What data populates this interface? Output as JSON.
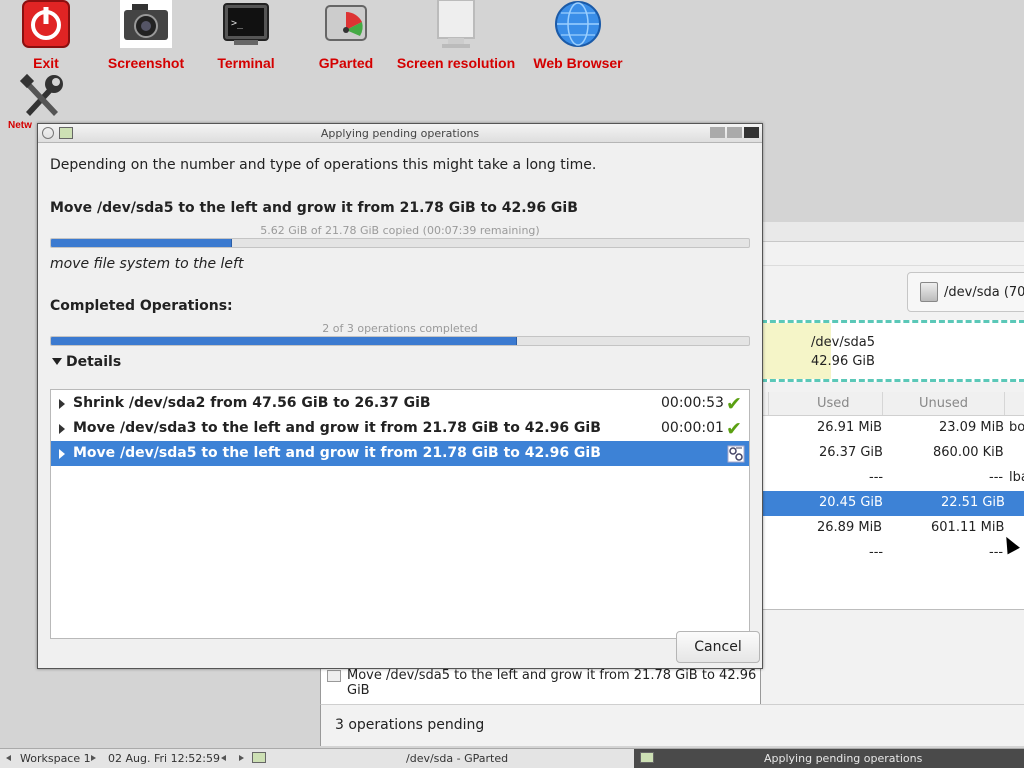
{
  "desktop": {
    "icons": [
      {
        "label": "Exit",
        "icon": "power-icon"
      },
      {
        "label": "Screenshot",
        "icon": "camera-icon"
      },
      {
        "label": "Terminal",
        "icon": "terminal-icon"
      },
      {
        "label": "GParted",
        "icon": "disk-icon"
      },
      {
        "label": "Screen resolution",
        "icon": "monitor-icon"
      },
      {
        "label": "Web Browser",
        "icon": "globe-icon"
      },
      {
        "label": "Netw",
        "icon": "network-tools-icon"
      }
    ]
  },
  "dialog": {
    "title": "Applying pending operations",
    "intro": "Depending on the number and type of operations this might take a long time.",
    "current_op": "Move /dev/sda5 to the left and grow it from 21.78 GiB to 42.96 GiB",
    "current_progress_text": "5.62 GiB of 21.78 GiB copied (00:07:39 remaining)",
    "current_progress": 0.26,
    "current_subtask": "move file system to the left",
    "completed_label": "Completed Operations:",
    "completed_text": "2 of 3 operations completed",
    "completed_progress": 0.667,
    "details_label": "Details",
    "operations": [
      {
        "label": "Shrink /dev/sda2 from 47.56 GiB to 26.37 GiB",
        "time": "00:00:53",
        "status": "done"
      },
      {
        "label": "Move /dev/sda3 to the left and grow it from 21.78 GiB to 42.96 GiB",
        "time": "00:00:01",
        "status": "done"
      },
      {
        "label": "Move /dev/sda5 to the left and grow it from 21.78 GiB to 42.96 GiB",
        "time": "",
        "status": "running"
      }
    ],
    "cancel_label": "Cancel"
  },
  "gparted": {
    "device_button": "/dev/sda (70.",
    "partmap": {
      "name": "/dev/sda5",
      "size": "42.96 GiB"
    },
    "columns": [
      "Used",
      "Unused",
      ""
    ],
    "rows": [
      {
        "used": "26.91 MiB",
        "unused": "23.09 MiB",
        "flags": "bo"
      },
      {
        "used": "26.37 GiB",
        "unused": "860.00 KiB",
        "flags": ""
      },
      {
        "used": "---",
        "unused": "---",
        "flags": "lba"
      },
      {
        "used": "20.45 GiB",
        "unused": "22.51 GiB",
        "flags": ""
      },
      {
        "used": "26.89 MiB",
        "unused": "601.11 MiB",
        "flags": ""
      },
      {
        "used": "---",
        "unused": "---",
        "flags": ""
      }
    ],
    "pending_op": "Move /dev/sda5 to the left and grow it from 21.78 GiB to 42.96 GiB",
    "status": "3 operations pending"
  },
  "taskbar": {
    "workspace": "Workspace 1",
    "datetime": "02 Aug. Fri 12:52:59",
    "task_gparted": "/dev/sda - GParted",
    "task_apply": "Applying pending operations"
  }
}
